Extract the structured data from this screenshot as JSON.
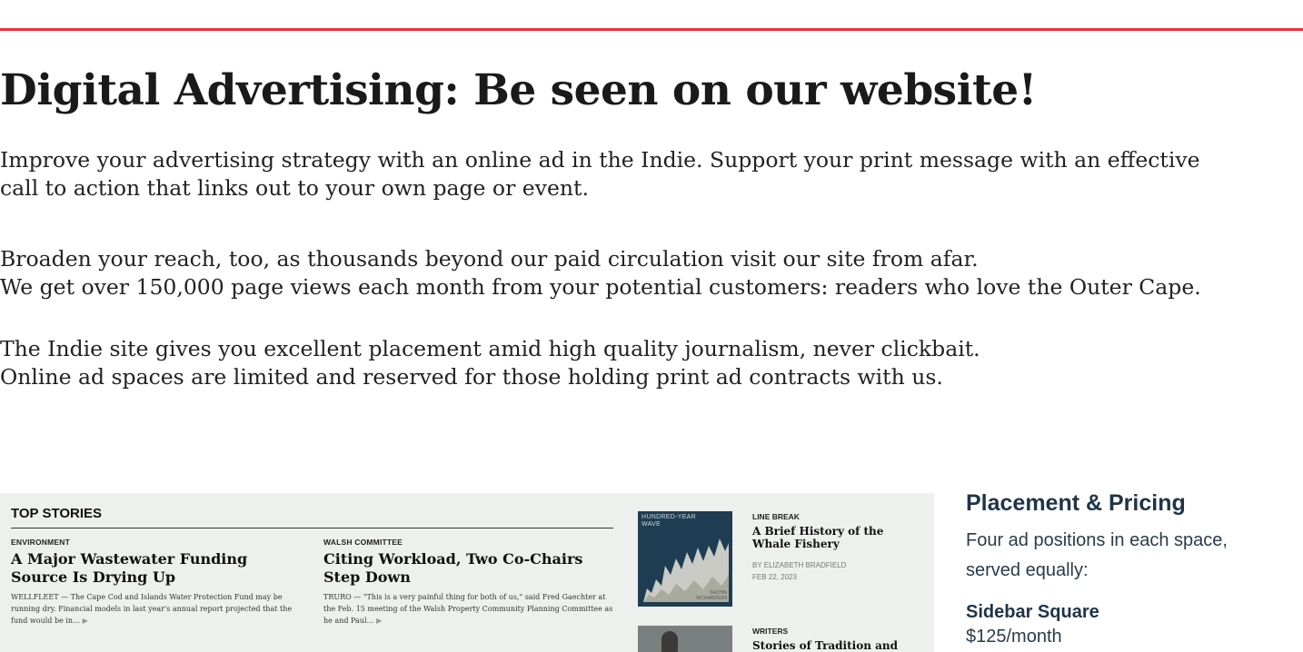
{
  "headline": "Digital Advertising: Be seen on our website!",
  "paragraphs": [
    {
      "lines": [
        "Improve your advertising strategy with an online ad in the Indie. Support your print message with an effective",
        "call to action that links out to your own page or event."
      ]
    },
    {
      "lines": [
        "Broaden your reach, too, as thousands beyond our paid circulation visit our site from afar.",
        "We get over 150,000 page views each month from your potential customers: readers who love the Outer Cape."
      ]
    },
    {
      "lines": [
        "The Indie site gives you excellent placement amid high quality journalism, never clickbait.",
        "Online ad spaces are limited and reserved for those holding print ad contracts with us."
      ]
    }
  ],
  "preview": {
    "section_label": "TOP STORIES",
    "stories": [
      {
        "kicker": "ENVIRONMENT",
        "title": "A Major Wastewater Funding Source Is Drying Up",
        "excerpt": "WELLFLEET — The Cape Cod and Islands Water Protection Fund may be running dry. Financial models in last year's annual report projected that the fund would be in…",
        "more": "▶"
      },
      {
        "kicker": "WALSH COMMITTEE",
        "title": "Citing Workload, Two Co-Chairs Step Down",
        "excerpt": "TRURO — \"This is a very painful thing for both of us,\" said Fred Gaechter at the Feb. 15 meeting of the Walsh Property Community Planning Committee as he and Paul…",
        "more": "▶"
      }
    ],
    "side_stories": [
      {
        "kicker": "LINE BREAK",
        "title": "A Brief History of the Whale Fishery",
        "byline": "BY ELIZABETH BRADFIELD",
        "date": "FEB 22, 2023",
        "thumb_label": "HUNDRED-YEAR WAVE",
        "thumb_author": "SACHIN RICHARDSON"
      },
      {
        "kicker": "WRITERS",
        "title": "Stories of Tradition and"
      }
    ]
  },
  "pricing": {
    "title": "Placement & Pricing",
    "description_lines": [
      "Four ad positions in each space,",
      "served equally:"
    ],
    "ad_types": [
      {
        "name": "Sidebar Square",
        "price": "$125/month"
      }
    ]
  },
  "colors": {
    "accent_rule": "#e2333d",
    "pricing_heading": "#1f3447",
    "preview_bg": "#eef0ee"
  }
}
